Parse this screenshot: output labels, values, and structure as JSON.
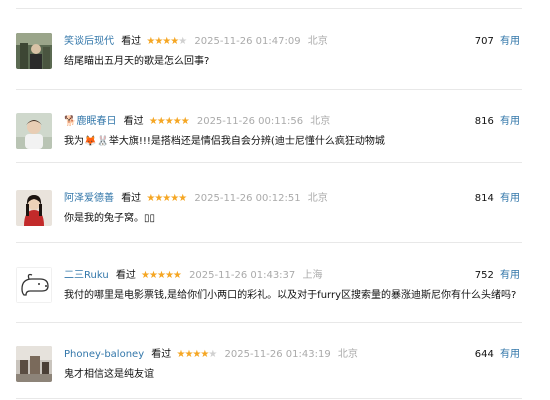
{
  "comments": [
    {
      "author": "笑谈后现代",
      "status": "看过",
      "rating": 4,
      "stars_text": "★★★★★",
      "time": "2025-11-26 01:47:09",
      "location": "北京",
      "votes": "707",
      "useful_label": "有用",
      "content": "结尾瞄出五月天的歌是怎么回事?"
    },
    {
      "author": "🐕鹿眠春日",
      "status": "看过",
      "rating": 5,
      "stars_text": "★★★★★",
      "time": "2025-11-26 00:11:56",
      "location": "北京",
      "votes": "816",
      "useful_label": "有用",
      "content": "我为🦊🐰举大旗!!!是搭档还是情侣我自会分辨(迪士尼懂什么疯狂动物城"
    },
    {
      "author": "阿泽爱德善",
      "status": "看过",
      "rating": 5,
      "stars_text": "★★★★★",
      "time": "2025-11-26 00:12:51",
      "location": "北京",
      "votes": "814",
      "useful_label": "有用",
      "content": "你是我的兔子窝。▯▯"
    },
    {
      "author": "二三Ruku",
      "status": "看过",
      "rating": 5,
      "stars_text": "★★★★★",
      "time": "2025-11-26 01:43:37",
      "location": "上海",
      "votes": "752",
      "useful_label": "有用",
      "content": "我付的哪里是电影票钱,是给你们小两口的彩礼。以及对于furry区搜索量的暴涨迪斯尼你有什么头绪吗?"
    },
    {
      "author": "Phoney-baloney",
      "status": "看过",
      "rating": 4,
      "stars_text": "★★★★★",
      "time": "2025-11-26 01:43:19",
      "location": "北京",
      "votes": "644",
      "useful_label": "有用",
      "content": "鬼才相信这是纯友谊"
    }
  ],
  "colors": {
    "author_link": "#3377aa",
    "star_on": "#f5a623",
    "star_off": "#d0d0d0",
    "meta_gray": "#aaaaaa",
    "divider": "#e8e8e8"
  },
  "icons": [
    "avatar-photo",
    "dog-face-icon"
  ]
}
